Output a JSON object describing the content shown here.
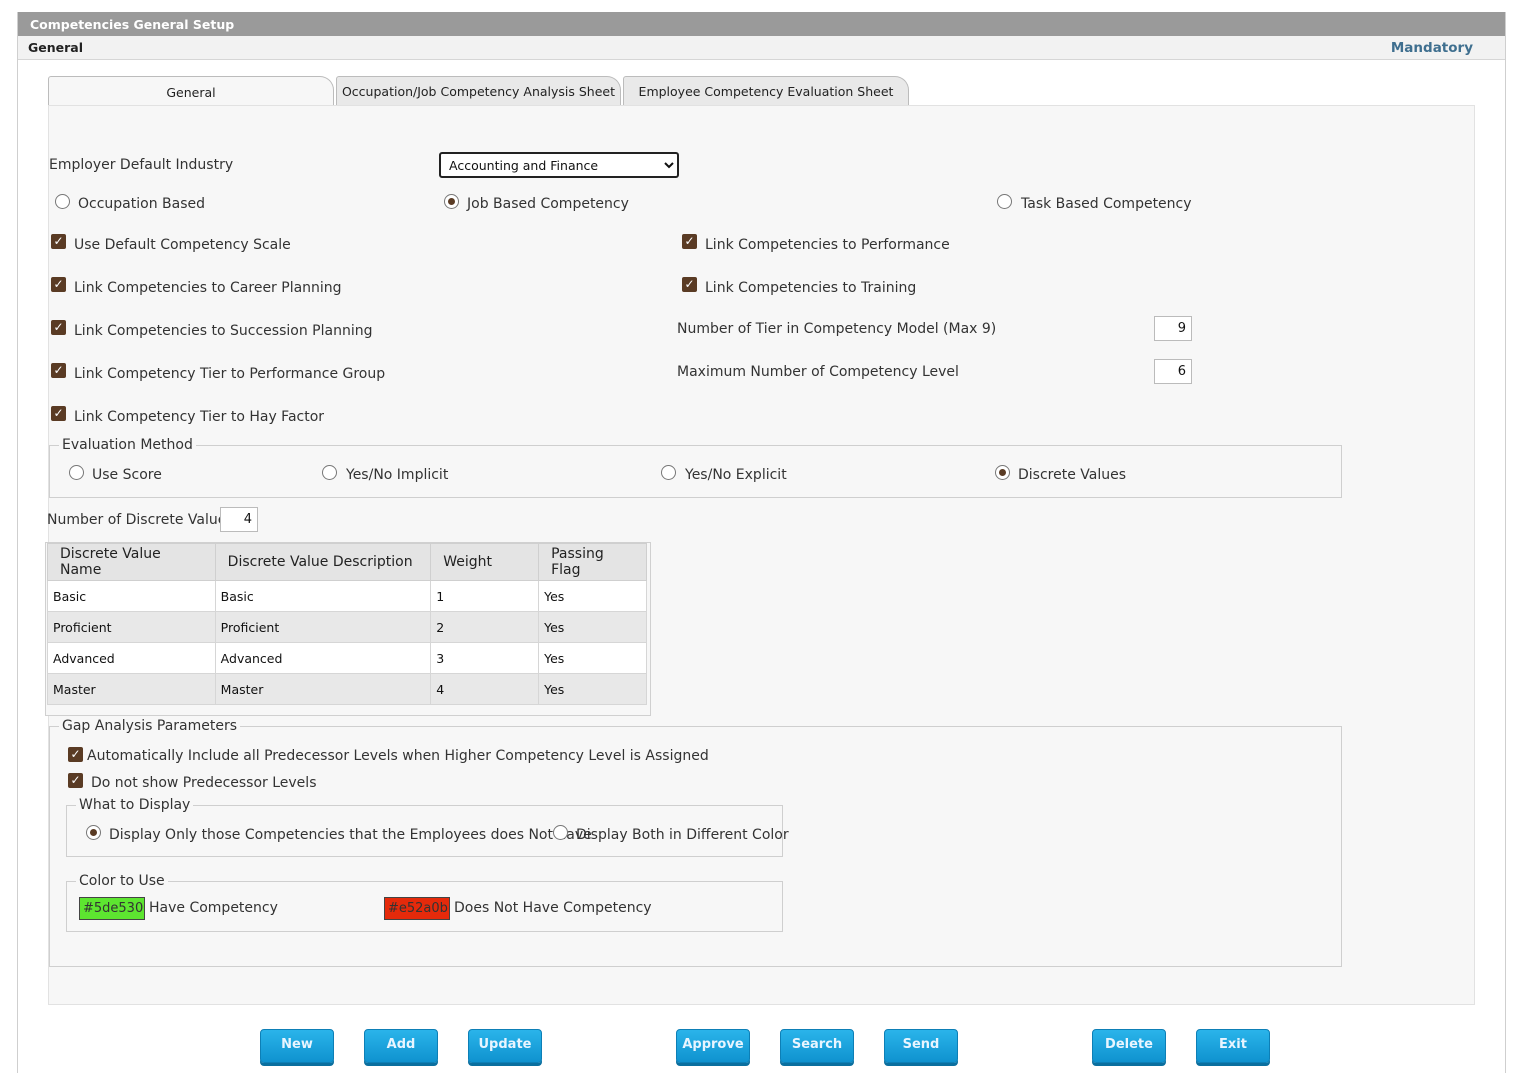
{
  "window": {
    "title": "Competencies General Setup"
  },
  "subheader": {
    "left": "General",
    "right": "Mandatory"
  },
  "tabs": [
    {
      "label": "General",
      "active": true
    },
    {
      "label": "Occupation/Job Competency Analysis Sheet",
      "active": false
    },
    {
      "label": "Employee Competency Evaluation Sheet",
      "active": false
    }
  ],
  "general": {
    "industry_label": "Employer Default Industry",
    "industry_value": "Accounting and Finance",
    "basis_options": [
      {
        "label": "Occupation Based",
        "selected": false
      },
      {
        "label": "Job Based Competency",
        "selected": true
      },
      {
        "label": "Task Based Competency",
        "selected": false
      }
    ],
    "checks_left": [
      {
        "label": "Use Default Competency Scale",
        "checked": true
      },
      {
        "label": "Link Competencies to Career Planning",
        "checked": true
      },
      {
        "label": "Link Competencies to Succession Planning",
        "checked": true
      },
      {
        "label": "Link Competency Tier to Performance Group",
        "checked": true
      },
      {
        "label": "Link Competency Tier to Hay Factor",
        "checked": true
      }
    ],
    "checks_right": [
      {
        "label": "Link Competencies to Performance",
        "checked": true
      },
      {
        "label": "Link Competencies to Training",
        "checked": true
      }
    ],
    "tier_label": "Number of Tier in Competency Model (Max 9)",
    "tier_value": "9",
    "max_level_label": "Maximum Number of Competency Level",
    "max_level_value": "6"
  },
  "evaluation": {
    "legend": "Evaluation Method",
    "options": [
      {
        "label": "Use Score",
        "selected": false
      },
      {
        "label": "Yes/No Implicit",
        "selected": false
      },
      {
        "label": "Yes/No Explicit",
        "selected": false
      },
      {
        "label": "Discrete Values",
        "selected": true
      }
    ],
    "discrete_count_label": "Number of Discrete Values",
    "discrete_count_value": "4"
  },
  "discrete_table": {
    "headers": [
      "Discrete Value Name",
      "Discrete Value Description",
      "Weight",
      "Passing Flag"
    ],
    "rows": [
      [
        "Basic",
        "Basic",
        "1",
        "Yes"
      ],
      [
        "Proficient",
        "Proficient",
        "2",
        "Yes"
      ],
      [
        "Advanced",
        "Advanced",
        "3",
        "Yes"
      ],
      [
        "Master",
        "Master",
        "4",
        "Yes"
      ]
    ]
  },
  "gap": {
    "legend": "Gap Analysis Parameters",
    "auto_include_label": "Automatically Include all Predecessor Levels when Higher Competency Level is Assigned",
    "no_predecessor_label": "Do not show Predecessor Levels",
    "display_legend": "What to Display",
    "display_options": [
      {
        "label": "Display Only those Competencies that the Employees does Not have",
        "selected": true
      },
      {
        "label": "Display Both in Different Color",
        "selected": false
      }
    ],
    "color_legend": "Color to Use",
    "have_color": "#5de530",
    "have_label": "Have Competency",
    "not_have_color": "#e52a0b",
    "not_have_label": "Does Not Have Competency"
  },
  "buttons": [
    "New",
    "Add",
    "Update",
    "Approve",
    "Search",
    "Send",
    "Delete",
    "Exit"
  ]
}
